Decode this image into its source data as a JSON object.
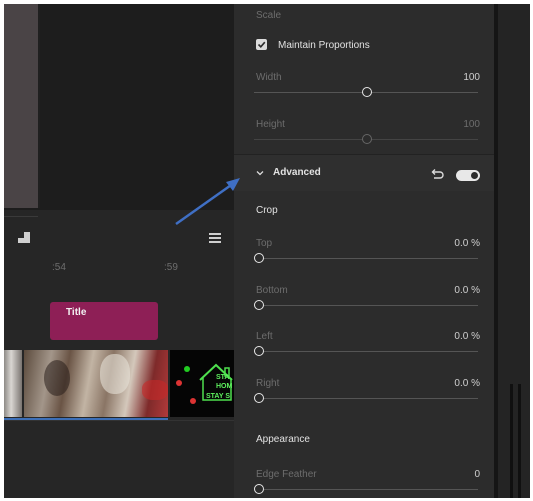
{
  "timeline": {
    "ruler_labels": [
      ":54",
      ":59"
    ],
    "title_clip_label": "Title",
    "neon_clip_text": [
      "STA",
      "HOM",
      "STAY S"
    ]
  },
  "panel": {
    "scale": {
      "heading": "Scale",
      "maintain_proportions_label": "Maintain Proportions",
      "maintain_proportions_checked": true,
      "width_label": "Width",
      "width_value": "100",
      "width_level": 0.5,
      "height_label": "Height",
      "height_value": "100",
      "height_level": 0.5
    },
    "advanced": {
      "title": "Advanced",
      "enabled": true,
      "crop_heading": "Crop",
      "crop": [
        {
          "label": "Top",
          "value": "0.0 %",
          "level": 0
        },
        {
          "label": "Bottom",
          "value": "0.0 %",
          "level": 0
        },
        {
          "label": "Left",
          "value": "0.0 %",
          "level": 0
        },
        {
          "label": "Right",
          "value": "0.0 %",
          "level": 0
        }
      ],
      "appearance_heading": "Appearance",
      "edge_feather_label": "Edge Feather",
      "edge_feather_value": "0",
      "edge_feather_level": 0
    }
  },
  "colors": {
    "accent_arrow": "#3f6fc4",
    "title_clip": "#8e1f56",
    "track_indicator": "#3c6fb8"
  },
  "icons": [
    "marker-icon",
    "hamburger-menu-icon",
    "checkmark-icon",
    "chevron-down-icon",
    "reset-icon",
    "toggle-switch",
    "annotation-arrow"
  ]
}
